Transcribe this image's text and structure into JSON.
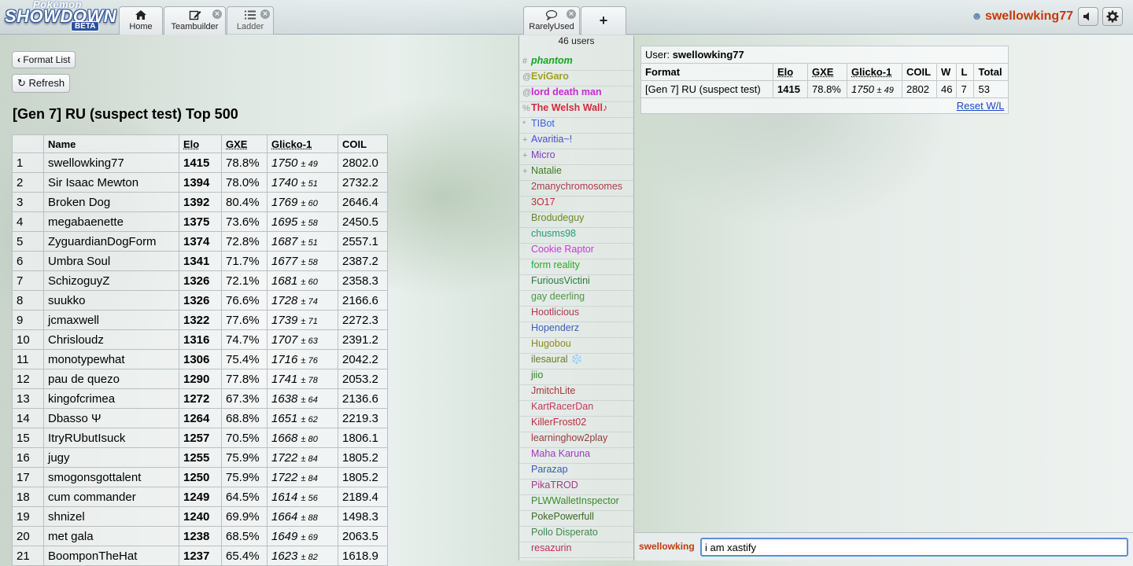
{
  "header": {
    "logo": {
      "line1": "Pokémon",
      "line2": "SHOWDOWN",
      "badge": "BETA"
    },
    "tabs": [
      {
        "label": "Home",
        "icon": "home-icon"
      },
      {
        "label": "Teambuilder",
        "icon": "edit-icon"
      },
      {
        "label": "Ladder",
        "icon": "list-icon"
      },
      {
        "label": "RarelyUsed",
        "icon": "chat-bubble-icon"
      }
    ],
    "new_tab_label": "+",
    "close_glyph": "×",
    "username": "swellowking77"
  },
  "ladder": {
    "format_list_label": "Format List",
    "refresh_label": "Refresh",
    "title": "[Gen 7] RU (suspect test) Top 500",
    "columns": [
      "",
      "Name",
      "Elo",
      "GXE",
      "Glicko-1",
      "COIL"
    ],
    "rows": [
      {
        "rank": "1",
        "name": "swellowking77",
        "elo": "1415",
        "gxe": "78.8%",
        "glicko": "1750",
        "dev": "± 49",
        "coil": "2802.0"
      },
      {
        "rank": "2",
        "name": "Sir Isaac Mewton",
        "elo": "1394",
        "gxe": "78.0%",
        "glicko": "1740",
        "dev": "± 51",
        "coil": "2732.2"
      },
      {
        "rank": "3",
        "name": "Broken Dog",
        "elo": "1392",
        "gxe": "80.4%",
        "glicko": "1769",
        "dev": "± 60",
        "coil": "2646.4"
      },
      {
        "rank": "4",
        "name": "megabaenette",
        "elo": "1375",
        "gxe": "73.6%",
        "glicko": "1695",
        "dev": "± 58",
        "coil": "2450.5"
      },
      {
        "rank": "5",
        "name": "ZyguardianDogForm",
        "elo": "1374",
        "gxe": "72.8%",
        "glicko": "1687",
        "dev": "± 51",
        "coil": "2557.1"
      },
      {
        "rank": "6",
        "name": "Umbra Soul",
        "elo": "1341",
        "gxe": "71.7%",
        "glicko": "1677",
        "dev": "± 58",
        "coil": "2387.2"
      },
      {
        "rank": "7",
        "name": "SchizoguyZ",
        "elo": "1326",
        "gxe": "72.1%",
        "glicko": "1681",
        "dev": "± 60",
        "coil": "2358.3"
      },
      {
        "rank": "8",
        "name": "suukko",
        "elo": "1326",
        "gxe": "76.6%",
        "glicko": "1728",
        "dev": "± 74",
        "coil": "2166.6"
      },
      {
        "rank": "9",
        "name": "jcmaxwell",
        "elo": "1322",
        "gxe": "77.6%",
        "glicko": "1739",
        "dev": "± 71",
        "coil": "2272.3"
      },
      {
        "rank": "10",
        "name": "Chrisloudz",
        "elo": "1316",
        "gxe": "74.7%",
        "glicko": "1707",
        "dev": "± 63",
        "coil": "2391.2"
      },
      {
        "rank": "11",
        "name": "monotypewhat",
        "elo": "1306",
        "gxe": "75.4%",
        "glicko": "1716",
        "dev": "± 76",
        "coil": "2042.2"
      },
      {
        "rank": "12",
        "name": "pau de quezo",
        "elo": "1290",
        "gxe": "77.8%",
        "glicko": "1741",
        "dev": "± 78",
        "coil": "2053.2"
      },
      {
        "rank": "13",
        "name": "kingofcrimea",
        "elo": "1272",
        "gxe": "67.3%",
        "glicko": "1638",
        "dev": "± 64",
        "coil": "2136.6"
      },
      {
        "rank": "14",
        "name": "Dbasso Ψ",
        "elo": "1264",
        "gxe": "68.8%",
        "glicko": "1651",
        "dev": "± 62",
        "coil": "2219.3"
      },
      {
        "rank": "15",
        "name": "ItryRUbutIsuck",
        "elo": "1257",
        "gxe": "70.5%",
        "glicko": "1668",
        "dev": "± 80",
        "coil": "1806.1"
      },
      {
        "rank": "16",
        "name": "jugy",
        "elo": "1255",
        "gxe": "75.9%",
        "glicko": "1722",
        "dev": "± 84",
        "coil": "1805.2"
      },
      {
        "rank": "17",
        "name": "smogonsgottalent",
        "elo": "1250",
        "gxe": "75.9%",
        "glicko": "1722",
        "dev": "± 84",
        "coil": "1805.2"
      },
      {
        "rank": "18",
        "name": "cum commander",
        "elo": "1249",
        "gxe": "64.5%",
        "glicko": "1614",
        "dev": "± 56",
        "coil": "2189.4"
      },
      {
        "rank": "19",
        "name": "shnizel",
        "elo": "1240",
        "gxe": "69.9%",
        "glicko": "1664",
        "dev": "± 88",
        "coil": "1498.3"
      },
      {
        "rank": "20",
        "name": "met gala",
        "elo": "1238",
        "gxe": "68.5%",
        "glicko": "1649",
        "dev": "± 69",
        "coil": "2063.5"
      },
      {
        "rank": "21",
        "name": "BoomponTheHat",
        "elo": "1237",
        "gxe": "65.4%",
        "glicko": "1623",
        "dev": "± 82",
        "coil": "1618.9"
      }
    ]
  },
  "userlist": {
    "count_label": "46 users",
    "users": [
      {
        "rank": "#",
        "name": "phantom",
        "color": "#0ea81e",
        "style": "bold-italic"
      },
      {
        "rank": "@",
        "name": "EviGaro",
        "color": "#a1a11e",
        "style": "staff"
      },
      {
        "rank": "@",
        "name": "lord death man",
        "color": "#c72ad6",
        "style": "staff"
      },
      {
        "rank": "%",
        "name": "The Welsh Wall♪",
        "color": "#d6283c",
        "style": "staff"
      },
      {
        "rank": "*",
        "name": "TIBot",
        "color": "#3a62d8",
        "style": ""
      },
      {
        "rank": "+",
        "name": "Avaritia~!",
        "color": "#4a4ad1",
        "style": ""
      },
      {
        "rank": "+",
        "name": "Micro",
        "color": "#7a3fb0",
        "style": ""
      },
      {
        "rank": "+",
        "name": "Natalie",
        "color": "#3f7a22",
        "style": ""
      },
      {
        "rank": "",
        "name": "2manychromosomes",
        "color": "#b5354a",
        "style": ""
      },
      {
        "rank": "",
        "name": "3O17",
        "color": "#c7293a",
        "style": ""
      },
      {
        "rank": "",
        "name": "Brodudeguy",
        "color": "#6a8a1e",
        "style": ""
      },
      {
        "rank": "",
        "name": "chusms98",
        "color": "#239a7a",
        "style": ""
      },
      {
        "rank": "",
        "name": "Cookie Raptor",
        "color": "#c23cd1",
        "style": ""
      },
      {
        "rank": "",
        "name": "form reality",
        "color": "#2aa82a",
        "style": ""
      },
      {
        "rank": "",
        "name": "FuriousVictini",
        "color": "#2a7a3a",
        "style": ""
      },
      {
        "rank": "",
        "name": "gay deerling",
        "color": "#4a9a3a",
        "style": ""
      },
      {
        "rank": "",
        "name": "Hootlicious",
        "color": "#b5354f",
        "style": ""
      },
      {
        "rank": "",
        "name": "Hopenderz",
        "color": "#3a5ec0",
        "style": ""
      },
      {
        "rank": "",
        "name": "Hugobou",
        "color": "#8a8a1e",
        "style": ""
      },
      {
        "rank": "",
        "name": "ilesaural ❄️",
        "color": "#6a7a2a",
        "style": ""
      },
      {
        "rank": "",
        "name": "jiio",
        "color": "#2a8a1e",
        "style": ""
      },
      {
        "rank": "",
        "name": "JmitchLite",
        "color": "#a03a3a",
        "style": ""
      },
      {
        "rank": "",
        "name": "KartRacerDan",
        "color": "#c03a5a",
        "style": ""
      },
      {
        "rank": "",
        "name": "KillerFrost02",
        "color": "#c02a3a",
        "style": ""
      },
      {
        "rank": "",
        "name": "learninghow2play",
        "color": "#9a3a3a",
        "style": ""
      },
      {
        "rank": "",
        "name": "Maha Karuna",
        "color": "#a03ac0",
        "style": ""
      },
      {
        "rank": "",
        "name": "Parazap",
        "color": "#3a5ab0",
        "style": ""
      },
      {
        "rank": "",
        "name": "PikaTROD",
        "color": "#a03a8a",
        "style": ""
      },
      {
        "rank": "",
        "name": "PLWWalletInspector",
        "color": "#3a8a2a",
        "style": ""
      },
      {
        "rank": "",
        "name": "PokePowerfull",
        "color": "#3a6a1e",
        "style": ""
      },
      {
        "rank": "",
        "name": "Pollo Disperato",
        "color": "#3a8a4a",
        "style": ""
      },
      {
        "rank": "",
        "name": "resazurin",
        "color": "#c02a5a",
        "style": ""
      }
    ]
  },
  "userstats": {
    "user_label": "User:",
    "username": "swellowking77",
    "columns": [
      "Format",
      "Elo",
      "GXE",
      "Glicko-1",
      "COIL",
      "W",
      "L",
      "Total"
    ],
    "row": {
      "format": "[Gen 7] RU (suspect test)",
      "elo": "1415",
      "gxe": "78.8%",
      "glicko": "1750",
      "dev": "± 49",
      "coil": "2802",
      "w": "46",
      "l": "7",
      "total": "53"
    },
    "reset_label": "Reset W/L"
  },
  "chat": {
    "name": "swellowking",
    "input_value": "i am xastify"
  },
  "colors": {
    "username": "#c1390b",
    "link": "#1a47c7",
    "input_focus": "#5b8fd1"
  }
}
